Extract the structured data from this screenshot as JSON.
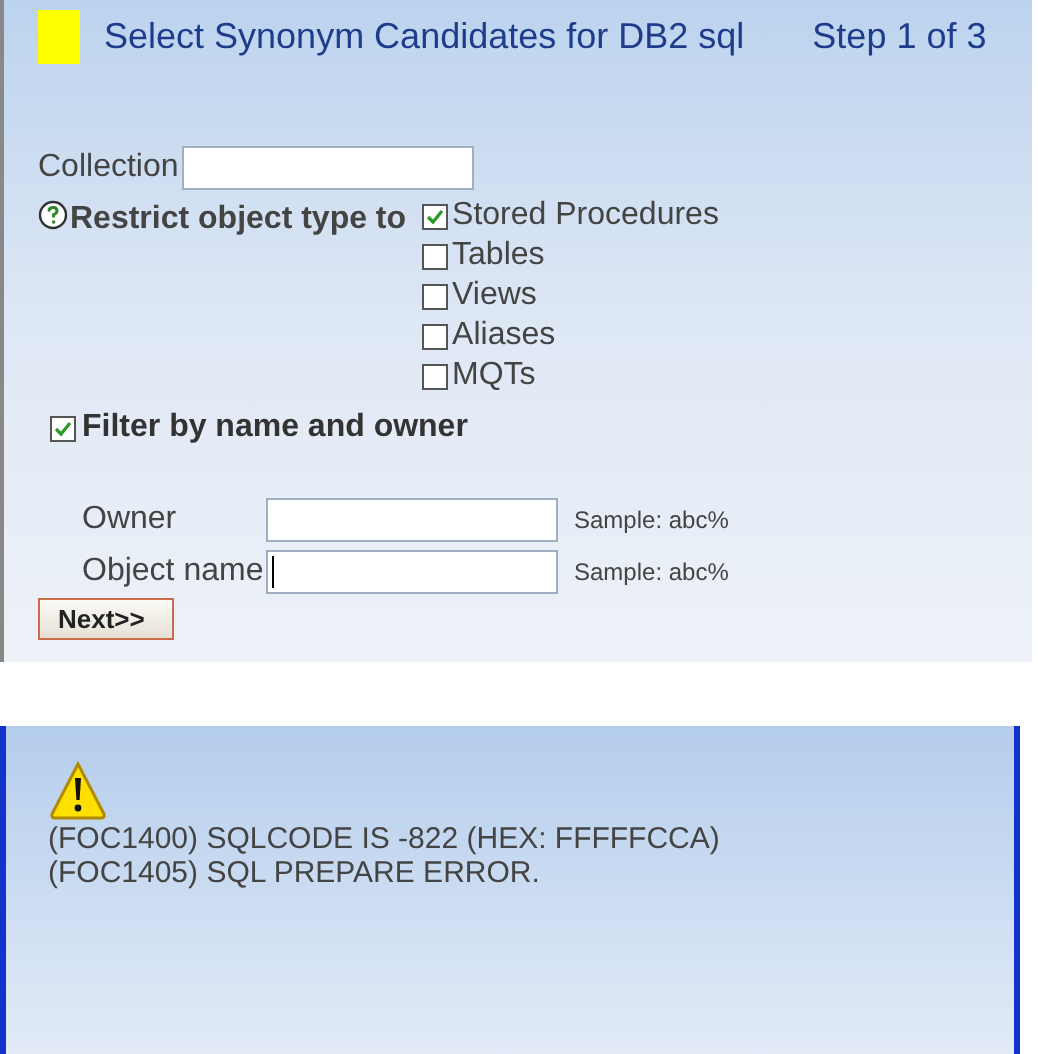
{
  "header": {
    "title": "Select Synonym Candidates for DB2 sql",
    "step": "Step 1 of 3"
  },
  "collection": {
    "label": "Collection"
  },
  "restrict": {
    "label": "Restrict object type to",
    "options": [
      {
        "label": "Stored Procedures",
        "checked": true
      },
      {
        "label": "Tables",
        "checked": false
      },
      {
        "label": "Views",
        "checked": false
      },
      {
        "label": "Aliases",
        "checked": false
      },
      {
        "label": "MQTs",
        "checked": false
      }
    ]
  },
  "filter": {
    "label": "Filter by name and owner",
    "checked": true,
    "fields": [
      {
        "label": "Owner",
        "hint": "Sample: abc%",
        "focused": false
      },
      {
        "label": "Object name",
        "hint": "Sample: abc%",
        "focused": true
      }
    ]
  },
  "next_button": "Next>>",
  "messages": [
    "(FOC1400) SQLCODE IS -822 (HEX: FFFFFCCA)",
    "(FOC1405) SQL PREPARE ERROR."
  ]
}
